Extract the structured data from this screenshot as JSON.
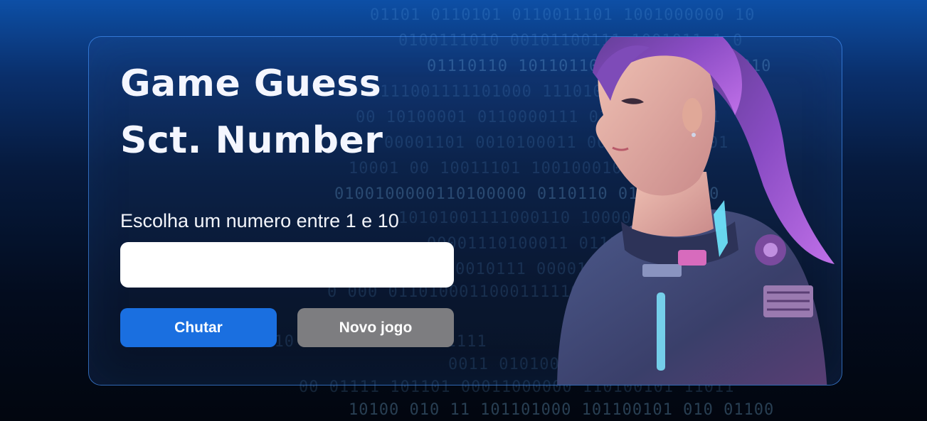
{
  "background": {
    "binary_lines": [
      "01101 0110101 0110011101 1001000000 10",
      "0100111010 00101100111 1001011 1 0",
      "01110110 10110110111010 0110100010",
      "0111001111101000 11101000011 0 0",
      "00 10100001 0110000111 01001 0010111",
      "00001101 0010100011 0000011 001101",
      "10001 00 10011101 10010001001 01101",
      "0100100000110100000 0110110 0100011 00",
      "10101001111000110 10000 110 10 0",
      "00001110100011 0111001 1000",
      "0010111 0000110111 011110 110",
      "0 000 011010001100011111011 0 11 10",
      "00000110 10 00000 0001 1111",
      "0011 010100001 11111000 11011",
      "00 01111 101101 00011000000 110100101 11011",
      "10100 010 11 101101000 101100101 010 01100"
    ],
    "accent_color": "#1a6fe0"
  },
  "card": {
    "title_line1": "Game Guess",
    "title_line2": "Sct. Number",
    "prompt": "Escolha um numero entre 1 e 10",
    "input_value": "",
    "guess_button_label": "Chutar",
    "new_game_button_label": "Novo jogo",
    "guess_button_color": "#1a6fe0",
    "new_game_button_color": "#7d7d80"
  },
  "illustration": {
    "subject": "cyberpunk-girl-purple-hair-armor"
  }
}
